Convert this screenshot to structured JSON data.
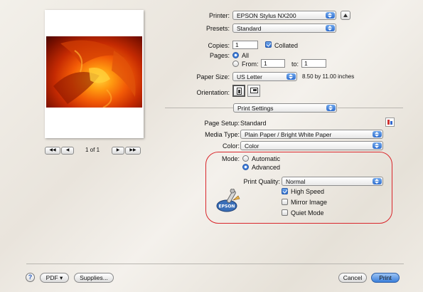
{
  "printer": {
    "label": "Printer:",
    "value": "EPSON Stylus NX200"
  },
  "presets": {
    "label": "Presets:",
    "value": "Standard"
  },
  "copies": {
    "label": "Copies:",
    "value": "1",
    "collated_label": "Collated",
    "collated": true
  },
  "pages": {
    "label": "Pages:",
    "all_label": "All",
    "from_label": "From:",
    "from_value": "1",
    "to_label": "to:",
    "to_value": "1"
  },
  "paper": {
    "label": "Paper Size:",
    "value": "US Letter",
    "dimensions": "8.50 by 11.00 inches"
  },
  "orientation": {
    "label": "Orientation:"
  },
  "section": {
    "value": "Print Settings"
  },
  "page_setup": {
    "label": "Page Setup:",
    "value": "Standard"
  },
  "media": {
    "label": "Media Type:",
    "value": "Plain Paper / Bright White Paper"
  },
  "color": {
    "label": "Color:",
    "value": "Color"
  },
  "mode": {
    "label": "Mode:",
    "automatic": "Automatic",
    "advanced": "Advanced",
    "selected": "Advanced"
  },
  "quality": {
    "label": "Print Quality:",
    "value": "Normal"
  },
  "options": [
    {
      "label": "High Speed",
      "checked": true
    },
    {
      "label": "Mirror Image",
      "checked": false
    },
    {
      "label": "Quiet Mode",
      "checked": false
    }
  ],
  "preview": {
    "page_info": "1 of 1"
  },
  "bottom": {
    "help": "?",
    "pdf": "PDF ▾",
    "supplies": "Supplies...",
    "cancel": "Cancel",
    "print": "Print"
  },
  "icons": {
    "epson_logo": "EPSON"
  },
  "colors": {
    "highlight": "#d9262b",
    "accent": "#3a7ad8"
  }
}
